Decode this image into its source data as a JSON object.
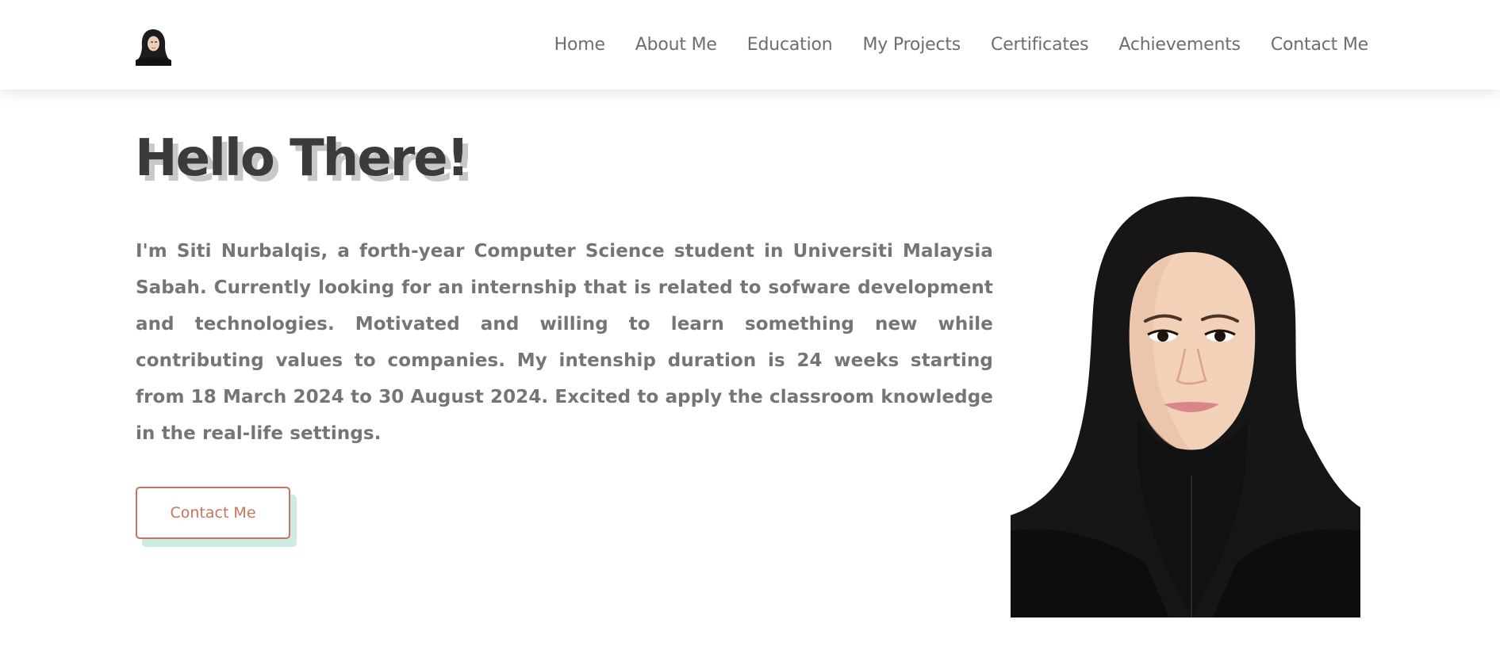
{
  "header": {
    "logo_icon": "profile-avatar-icon",
    "nav": [
      {
        "label": "Home"
      },
      {
        "label": "About Me"
      },
      {
        "label": "Education"
      },
      {
        "label": "My Projects"
      },
      {
        "label": "Certificates"
      },
      {
        "label": "Achievements"
      },
      {
        "label": "Contact Me"
      }
    ]
  },
  "hero": {
    "title": "Hello There!",
    "intro": "I'm Siti Nurbalqis, a forth-year Computer Science student in Universiti Malaysia Sabah. Currently looking for an internship that is related to sofware development and technologies. Motivated and willing to learn something new while contributing values to companies. My intenship duration is 24 weeks starting from 18 March 2024 to 30 August 2024. Excited to apply the classroom knowledge in the real-life settings.",
    "contact_button": "Contact Me",
    "portrait_icon": "profile-photo"
  },
  "colors": {
    "title": "#3b3b3b",
    "title_shadow": "#c8c8c8",
    "body_text": "#757575",
    "nav_text": "#6e6e6e",
    "accent": "#c9735e",
    "button_shadow": "#cdebe2"
  }
}
